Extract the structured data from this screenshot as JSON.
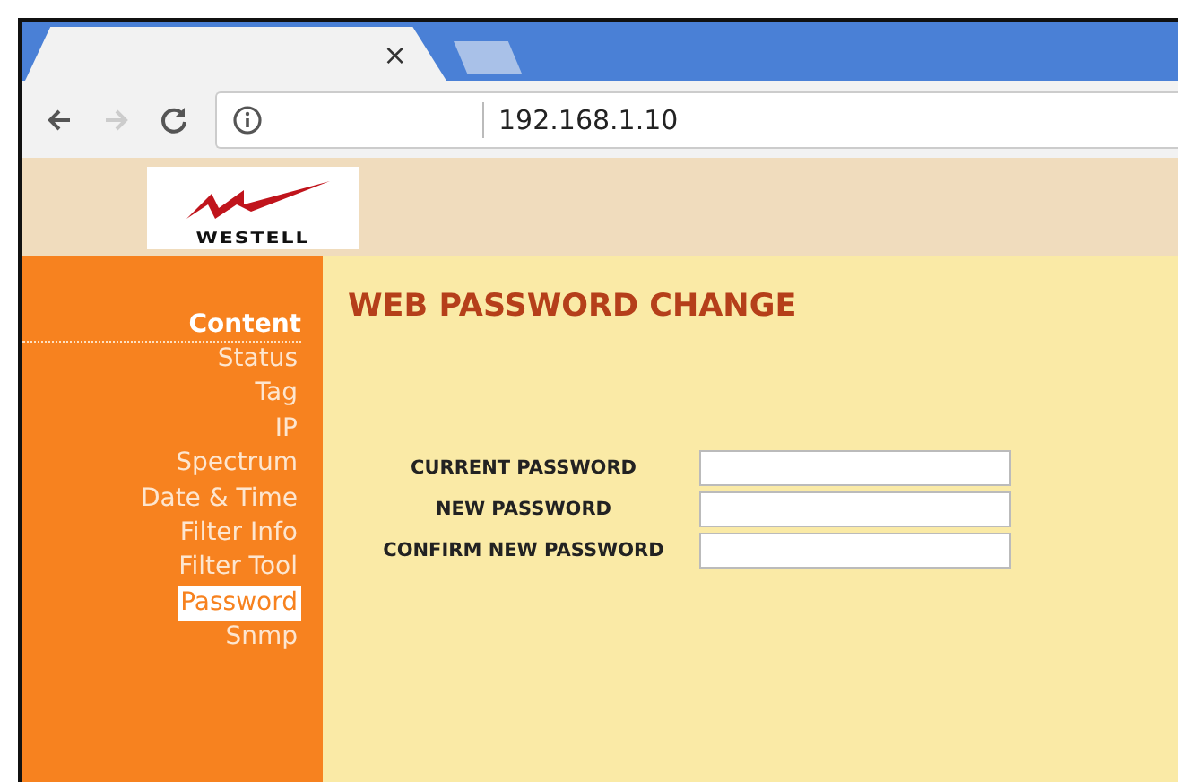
{
  "browser": {
    "tab_close": "×",
    "url": "192.168.1.10"
  },
  "logo": {
    "text": "WESTELL"
  },
  "sidebar": {
    "heading": "Content",
    "items": [
      {
        "label": "Status",
        "selected": false
      },
      {
        "label": "Tag",
        "selected": false
      },
      {
        "label": "IP",
        "selected": false
      },
      {
        "label": "Spectrum",
        "selected": false
      },
      {
        "label": "Date & Time",
        "selected": false
      },
      {
        "label": "Filter Info",
        "selected": false
      },
      {
        "label": "Filter Tool",
        "selected": false
      },
      {
        "label": "Password",
        "selected": true
      },
      {
        "label": "Snmp",
        "selected": false
      }
    ]
  },
  "page": {
    "title": "WEB PASSWORD CHANGE",
    "fields": [
      {
        "label": "CURRENT PASSWORD"
      },
      {
        "label": "NEW PASSWORD"
      },
      {
        "label": "CONFIRM NEW PASSWORD"
      }
    ]
  }
}
